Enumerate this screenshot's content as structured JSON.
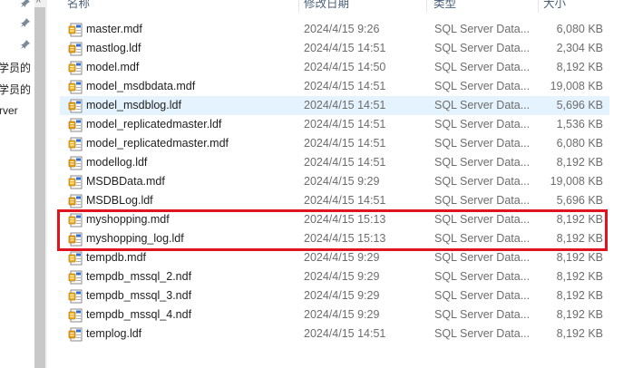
{
  "nav": {
    "items": [
      "学员的",
      "学员的",
      "rver"
    ],
    "up_arrow": "^"
  },
  "header": {
    "name": "名称",
    "date": "修改日期",
    "type": "类型",
    "size": "大小"
  },
  "files": [
    {
      "name": "master.mdf",
      "date": "2024/4/15 9:26",
      "type": "SQL Server Data...",
      "size": "6,080 KB",
      "icon": "sql-database-file-icon"
    },
    {
      "name": "mastlog.ldf",
      "date": "2024/4/15 14:51",
      "type": "SQL Server Data...",
      "size": "2,304 KB",
      "icon": "sql-log-file-icon"
    },
    {
      "name": "model.mdf",
      "date": "2024/4/15 14:50",
      "type": "SQL Server Data...",
      "size": "8,192 KB",
      "icon": "sql-database-file-icon"
    },
    {
      "name": "model_msdbdata.mdf",
      "date": "2024/4/15 14:51",
      "type": "SQL Server Data...",
      "size": "19,008 KB",
      "icon": "sql-database-file-icon"
    },
    {
      "name": "model_msdblog.ldf",
      "date": "2024/4/15 14:51",
      "type": "SQL Server Data...",
      "size": "5,696 KB",
      "icon": "sql-log-file-icon"
    },
    {
      "name": "model_replicatedmaster.ldf",
      "date": "2024/4/15 14:51",
      "type": "SQL Server Data...",
      "size": "1,536 KB",
      "icon": "sql-log-file-icon"
    },
    {
      "name": "model_replicatedmaster.mdf",
      "date": "2024/4/15 14:51",
      "type": "SQL Server Data...",
      "size": "6,080 KB",
      "icon": "sql-database-file-icon"
    },
    {
      "name": "modellog.ldf",
      "date": "2024/4/15 14:51",
      "type": "SQL Server Data...",
      "size": "8,192 KB",
      "icon": "sql-log-file-icon"
    },
    {
      "name": "MSDBData.mdf",
      "date": "2024/4/15 9:29",
      "type": "SQL Server Data...",
      "size": "19,008 KB",
      "icon": "sql-database-file-icon"
    },
    {
      "name": "MSDBLog.ldf",
      "date": "2024/4/15 14:51",
      "type": "SQL Server Data...",
      "size": "5,696 KB",
      "icon": "sql-log-file-icon"
    },
    {
      "name": "myshopping.mdf",
      "date": "2024/4/15 15:13",
      "type": "SQL Server Data...",
      "size": "8,192 KB",
      "icon": "sql-database-file-icon"
    },
    {
      "name": "myshopping_log.ldf",
      "date": "2024/4/15 15:13",
      "type": "SQL Server Data...",
      "size": "8,192 KB",
      "icon": "sql-log-file-icon"
    },
    {
      "name": "tempdb.mdf",
      "date": "2024/4/15 9:29",
      "type": "SQL Server Data...",
      "size": "8,192 KB",
      "icon": "sql-database-file-icon"
    },
    {
      "name": "tempdb_mssql_2.ndf",
      "date": "2024/4/15 9:29",
      "type": "SQL Server Data...",
      "size": "8,192 KB",
      "icon": "sql-database-file-icon"
    },
    {
      "name": "tempdb_mssql_3.ndf",
      "date": "2024/4/15 9:29",
      "type": "SQL Server Data...",
      "size": "8,192 KB",
      "icon": "sql-database-file-icon"
    },
    {
      "name": "tempdb_mssql_4.ndf",
      "date": "2024/4/15 9:29",
      "type": "SQL Server Data...",
      "size": "8,192 KB",
      "icon": "sql-database-file-icon"
    },
    {
      "name": "templog.ldf",
      "date": "2024/4/15 14:51",
      "type": "SQL Server Data...",
      "size": "8,192 KB",
      "icon": "sql-log-file-icon"
    }
  ],
  "selected_file": "model_msdblog.ldf",
  "highlighted_files": [
    "myshopping.mdf",
    "myshopping_log.ldf"
  ],
  "colors": {
    "highlight_border": "#e0141e",
    "selection_background": "#e5f3ff",
    "header_text": "#4c607a"
  }
}
